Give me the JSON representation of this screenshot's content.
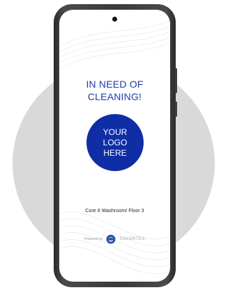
{
  "sign": {
    "headline_line1": "IN NEED OF",
    "headline_line2": "CLEANING!",
    "logo_line1": "YOUR",
    "logo_line2": "LOGO",
    "logo_line3": "HERE",
    "location": "Core 6 Washroom/ Floor 3",
    "powered_by": "Powered by",
    "brand_name": "SAVORTEX"
  },
  "colors": {
    "accent": "#1f3aa8",
    "logo_fill": "#0f2ea6",
    "background_circle": "#d9d9d9",
    "phone_frame": "#3a3a3a"
  },
  "icons": {
    "brand": "savortex-logo-icon",
    "camera": "front-camera-icon"
  }
}
